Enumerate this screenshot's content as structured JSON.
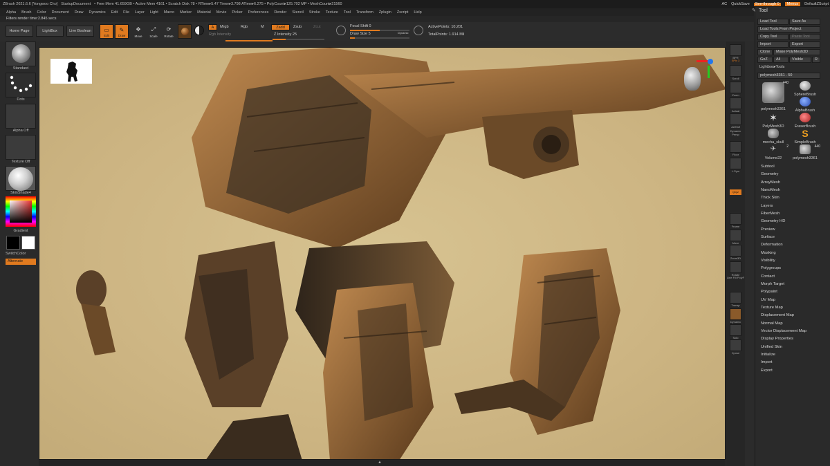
{
  "titlebar": {
    "items": [
      "ZBrush 2021.6.6 [Yongwoo Cho]",
      "StartupDocument",
      "• Free Mem 41.659GB • Active Mem 4161 • Scratch Disk 78 • RTime▸5.47 Timer▸3.798 ATime▸6.275 • PolyCount▸125.702 MP • MeshCount▸21560"
    ],
    "right_ac": "AC",
    "quicksave": "QuickSave",
    "see_through": "See-through 0",
    "menus": "Menus",
    "default_zscript": "DefaultZScript"
  },
  "menubar": [
    "Alpha",
    "Brush",
    "Color",
    "Document",
    "Draw",
    "Dynamics",
    "Edit",
    "File",
    "Layer",
    "Light",
    "Macro",
    "Marker",
    "Material",
    "Movie",
    "Picker",
    "Preferences",
    "Render",
    "Stencil",
    "Stroke",
    "Texture",
    "Tool",
    "Transform",
    "Zplugin",
    "Zscript",
    "Help"
  ],
  "statusline": "Filters render time:2.845 secs",
  "toolbar": {
    "home_page": "Home Page",
    "lightbox": "LightBox",
    "live_boolean": "Live Boolean",
    "edit": "Edit",
    "draw": "Draw",
    "move": "Move",
    "scale": "Scale",
    "rotate": "Rotate",
    "a": "A",
    "mrgb": "Mrgb",
    "rgb": "Rgb",
    "m": "M",
    "rgb_intensity": "Rgb Intensity",
    "zadd": "Zadd",
    "zsub": "Zsub",
    "zcut": "Zcut",
    "z_intensity": "Z Intensity 25",
    "z_intensity_value": 25,
    "focal_shift": "Focal Shift 0",
    "focal_shift_value": 0,
    "draw_size": "Draw Size 5",
    "draw_size_value": 5,
    "dynamic": "Dynamic",
    "active_points": "ActivePoints: 10,201",
    "total_points": "TotalPoints: 1.914 Mil"
  },
  "leftshelf": {
    "standard": "Standard",
    "dots": "Dots",
    "alpha_off": "Alpha Off",
    "texture_off": "Texture Off",
    "material": "SkinShade4",
    "gradient": "Gradient",
    "switch_color": "SwitchColor",
    "alternate": "Alternate"
  },
  "rightshelf": [
    "BPR",
    "SPix 3",
    "Scroll",
    "Zoom",
    "Actual",
    "AAHalf",
    "Dynamic Persp",
    "Floor",
    "L.Sym",
    "Qxyz",
    "Frame",
    "Move",
    "Zoom3D",
    "Rotate",
    "Line Fill PolyF",
    "Transp",
    "Dynamic",
    "Solo",
    "Xpose"
  ],
  "toolpanel": {
    "title": "Tool",
    "load_tool": "Load Tool",
    "save_as": "Save As",
    "load_from_project": "Load Tools From Project",
    "copy_tool": "Copy Tool",
    "paste_tool": "Paste Tool",
    "import": "Import",
    "export": "Export",
    "clone": "Clone",
    "make_polymesh": "Make PolyMesh3D",
    "goz": "GoZ",
    "all": "All",
    "visible": "Visible",
    "r": "R",
    "lightbox_tools": "Lightbox▸Tools",
    "current_tool": "polymesh3361 . 50",
    "tools": [
      {
        "name": "polymesh3361",
        "count": "440"
      },
      {
        "name": "SphereBrush",
        "count": ""
      },
      {
        "name": "AlphaBrush",
        "count": ""
      },
      {
        "name": "PolyMesh3D",
        "count": ""
      },
      {
        "name": "EraserBrush",
        "count": ""
      },
      {
        "name": "mecha_skull",
        "count": ""
      },
      {
        "name": "SimpleBrush",
        "count": ""
      },
      {
        "name": "Volume22",
        "count": "2"
      },
      {
        "name": "polymesh3361",
        "count": "440"
      }
    ],
    "palettes": [
      "Subtool",
      "Geometry",
      "ArrayMesh",
      "NanoMesh",
      "Thick Skin",
      "Layers",
      "FiberMesh",
      "Geometry HD",
      "Preview",
      "Surface",
      "Deformation",
      "Masking",
      "Visibility",
      "Polygroups",
      "Contact",
      "Morph Target",
      "Polypaint",
      "UV Map",
      "Texture Map",
      "Displacement Map",
      "Normal Map",
      "Vector Displacement Map",
      "Display Properties",
      "Unified Skin",
      "Initialize",
      "Import",
      "Export"
    ]
  },
  "colors": {
    "accent": "#e07a1f",
    "canvas_bg": "#cdb583",
    "ui_bg": "#2a2a2a"
  }
}
